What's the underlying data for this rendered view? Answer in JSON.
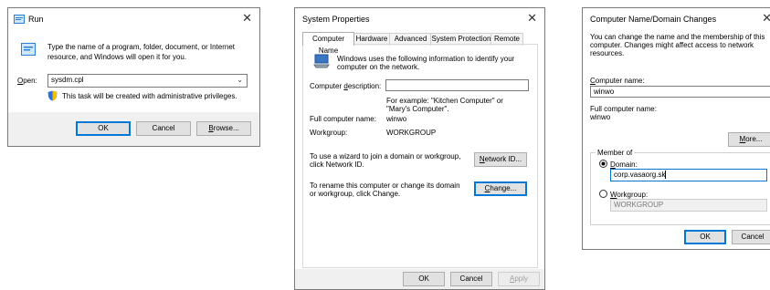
{
  "run": {
    "title": "Run",
    "description": "Type the name of a program, folder, document, or Internet resource, and Windows will open it for you.",
    "open_label": "Open:",
    "open_value": "sysdm.cpl",
    "admin_note": "This task will be created with administrative privileges.",
    "ok": "OK",
    "cancel": "Cancel",
    "browse": "Browse..."
  },
  "sysprops": {
    "title": "System Properties",
    "tabs": [
      "Computer Name",
      "Hardware",
      "Advanced",
      "System Protection",
      "Remote"
    ],
    "intro": "Windows uses the following information to identify your computer on the network.",
    "description_label": "Computer description:",
    "description_value": "",
    "example": "For example: \"Kitchen Computer\" or \"Mary's Computer\".",
    "full_name_label": "Full computer name:",
    "full_name_value": "winwo",
    "workgroup_label": "Workgroup:",
    "workgroup_value": "WORKGROUP",
    "wizard_text": "To use a wizard to join a domain or workgroup, click Network ID.",
    "network_id_button": "Network ID...",
    "rename_text": "To rename this computer or change its domain or workgroup, click Change.",
    "change_button": "Change...",
    "ok": "OK",
    "cancel": "Cancel",
    "apply": "Apply"
  },
  "namechanges": {
    "title": "Computer Name/Domain Changes",
    "intro": "You can change the name and the membership of this computer. Changes might affect access to network resources.",
    "computer_name_label": "Computer name:",
    "computer_name_value": "winwo",
    "full_name_label": "Full computer name:",
    "full_name_value": "winwo",
    "more_button": "More...",
    "member_of_label": "Member of",
    "domain_label": "Domain:",
    "domain_value": "corp.vasaorg.sk",
    "workgroup_label": "Workgroup:",
    "workgroup_value": "WORKGROUP",
    "ok": "OK",
    "cancel": "Cancel"
  },
  "colors": {
    "accent": "#0078d7",
    "button": "#e1e1e1",
    "footer": "#f0f0f0",
    "border": "#7a7a7a"
  }
}
